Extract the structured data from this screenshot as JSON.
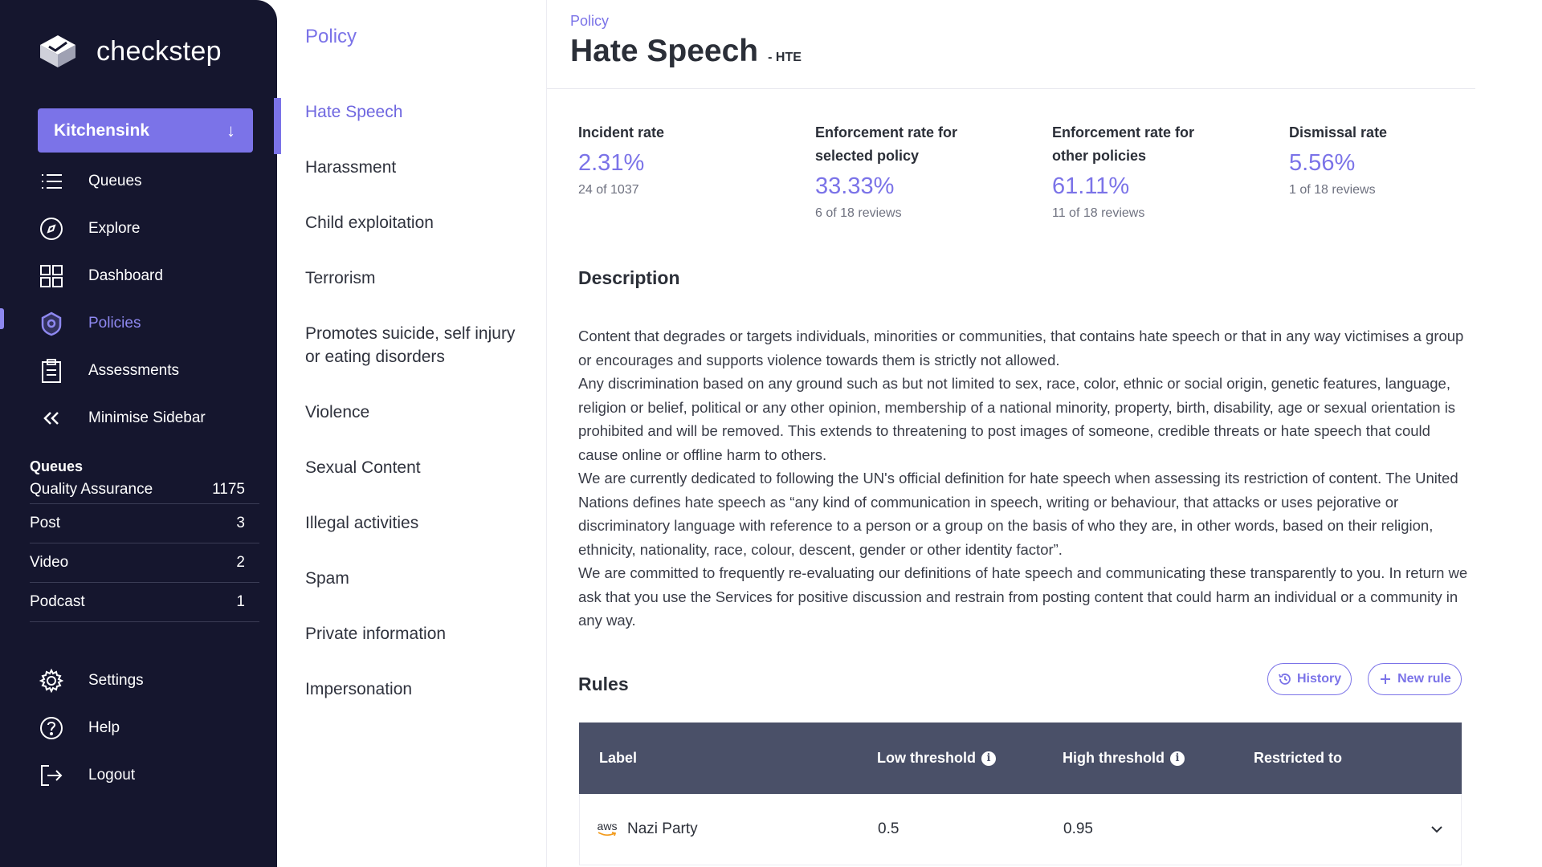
{
  "sidebar": {
    "brand": "checkstep",
    "workspace": "Kitchensink",
    "nav": [
      {
        "label": "Queues",
        "icon": "list-icon"
      },
      {
        "label": "Explore",
        "icon": "compass-icon"
      },
      {
        "label": "Dashboard",
        "icon": "grid-icon"
      },
      {
        "label": "Policies",
        "icon": "shield-icon",
        "active": true
      },
      {
        "label": "Assessments",
        "icon": "clipboard-icon"
      },
      {
        "label": "Minimise Sidebar",
        "icon": "double-chevron-left-icon"
      }
    ],
    "queues": {
      "title": "Queues",
      "items": [
        {
          "label": "Quality Assurance",
          "count": "1175"
        },
        {
          "label": "Post",
          "count": "3"
        },
        {
          "label": "Video",
          "count": "2"
        },
        {
          "label": "Podcast",
          "count": "1"
        }
      ]
    },
    "bottom_nav": [
      {
        "label": "Settings",
        "icon": "gear-icon"
      },
      {
        "label": "Help",
        "icon": "help-icon"
      },
      {
        "label": "Logout",
        "icon": "logout-icon"
      }
    ]
  },
  "policy_panel": {
    "heading": "Policy",
    "items": [
      {
        "label": "Hate Speech",
        "active": true
      },
      {
        "label": "Harassment"
      },
      {
        "label": "Child exploitation"
      },
      {
        "label": "Terrorism"
      },
      {
        "label": "Promotes suicide, self injury or eating disorders"
      },
      {
        "label": "Violence"
      },
      {
        "label": "Sexual Content"
      },
      {
        "label": "Illegal activities"
      },
      {
        "label": "Spam"
      },
      {
        "label": "Private information"
      },
      {
        "label": "Impersonation"
      }
    ]
  },
  "main": {
    "breadcrumb": "Policy",
    "title": "Hate Speech",
    "code": "- HTE",
    "stats": [
      {
        "label": "Incident rate",
        "value": "2.31%",
        "sub": "24 of 1037"
      },
      {
        "label": "Enforcement rate for selected policy",
        "value": "33.33%",
        "sub": "6 of 18 reviews"
      },
      {
        "label": "Enforcement rate for other policies",
        "value": "61.11%",
        "sub": "11 of 18 reviews"
      },
      {
        "label": "Dismissal rate",
        "value": "5.56%",
        "sub": "1 of 18 reviews"
      }
    ],
    "description_title": "Description",
    "description": "Content that degrades or targets individuals, minorities or communities, that contains hate speech or that in any way victimises a group or encourages and supports violence towards them is strictly not allowed.\nAny discrimination based on any ground such as but not limited to sex, race, color, ethnic or social origin, genetic features, language, religion or belief, political or any other opinion, membership of a national minority, property, birth, disability, age or sexual orientation is prohibited and will be removed. This extends to threatening to post images of someone, credible threats or hate speech that could cause online or offline harm to others.\nWe are currently dedicated to following the UN's official definition for hate speech when assessing its restriction of content. The United Nations defines hate speech as “any kind of communication in speech, writing or behaviour, that attacks or uses pejorative or discriminatory language with reference to a person or a group on the basis of who they are, in other words, based on their religion, ethnicity, nationality, race, colour, descent, gender or other identity factor”.\nWe are committed to frequently re-evaluating our definitions of hate speech and communicating these transparently to you. In return we ask that you use the Services for positive discussion and restrain from posting content that could harm an individual or a community in any way.",
    "rules_title": "Rules",
    "history_label": "History",
    "new_rule_label": "New rule",
    "table": {
      "headers": {
        "label": "Label",
        "low": "Low threshold",
        "high": "High threshold",
        "restricted": "Restricted to"
      },
      "rows": [
        {
          "provider": "aws",
          "label": "Nazi Party",
          "low": "0.5",
          "high": "0.95",
          "restricted": ""
        }
      ]
    }
  },
  "colors": {
    "sidebar_bg": "#15162e",
    "accent": "#7b73e8",
    "table_header": "#4a5068"
  }
}
